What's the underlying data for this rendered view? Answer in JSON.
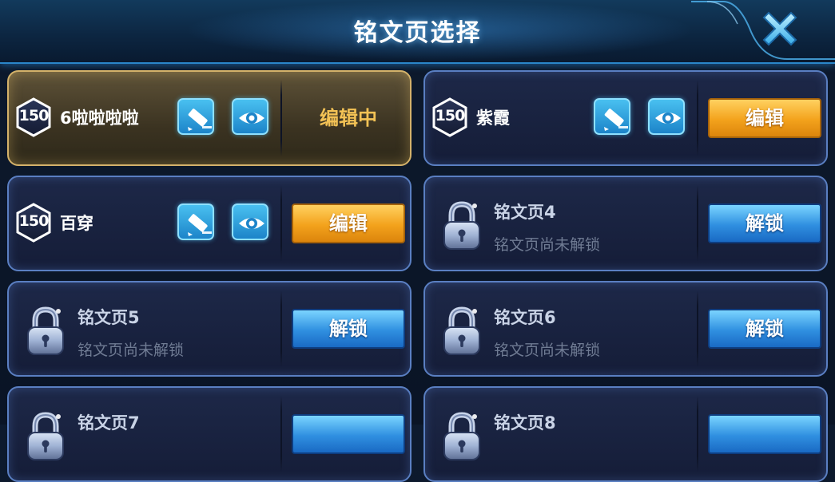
{
  "header": {
    "title": "铭文页选择",
    "close_icon": "close-x-icon"
  },
  "colors": {
    "active_border": "#d4b26a",
    "card_border": "#5a7fc2",
    "orange_button": "#f3a21c",
    "blue_button": "#2f8fe0",
    "editing_text": "#f3c255"
  },
  "pages": [
    {
      "level": "150",
      "name": "6啦啦啦啦",
      "status": "编辑中",
      "edit_icon": "pencil-icon",
      "view_icon": "eye-icon"
    },
    {
      "level": "150",
      "name": "紫霞",
      "action": "编辑",
      "edit_icon": "pencil-icon",
      "view_icon": "eye-icon"
    },
    {
      "level": "150",
      "name": "百穿",
      "action": "编辑",
      "edit_icon": "pencil-icon",
      "view_icon": "eye-icon"
    },
    {
      "name": "铭文页4",
      "sub": "铭文页尚未解锁",
      "action": "解锁",
      "icon": "lock-icon"
    },
    {
      "name": "铭文页5",
      "sub": "铭文页尚未解锁",
      "action": "解锁",
      "icon": "lock-icon"
    },
    {
      "name": "铭文页6",
      "sub": "铭文页尚未解锁",
      "action": "解锁",
      "icon": "lock-icon"
    },
    {
      "name": "铭文页7",
      "icon": "lock-icon"
    },
    {
      "name": "铭文页8",
      "icon": "lock-icon"
    }
  ]
}
